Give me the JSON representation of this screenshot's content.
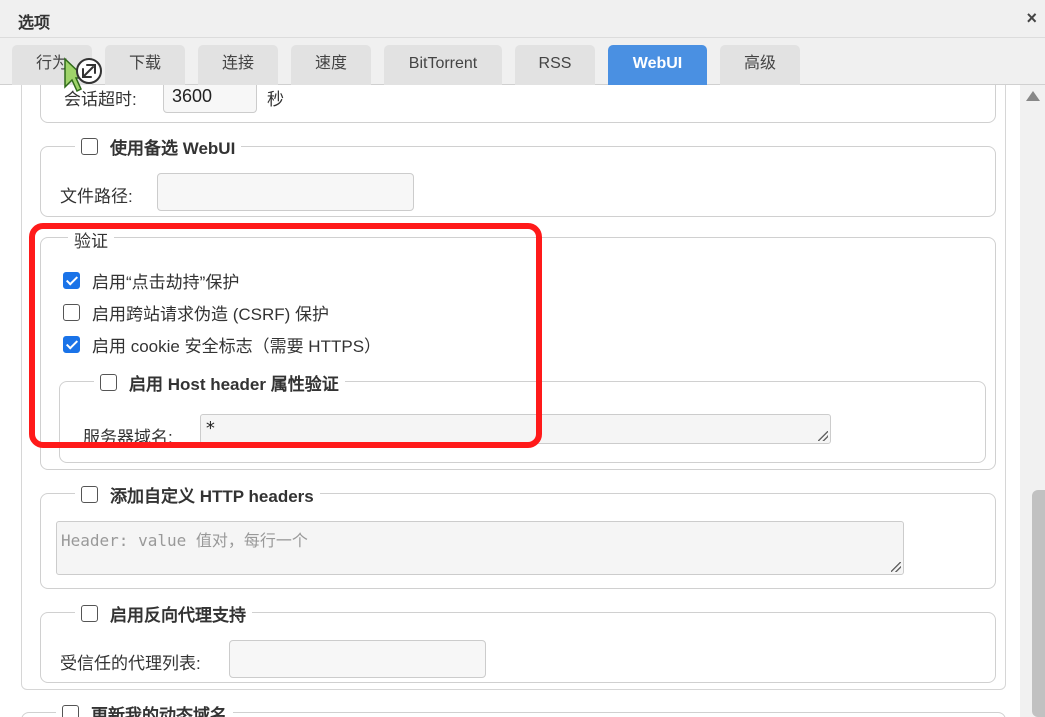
{
  "window": {
    "title": "选项",
    "close_label": "×"
  },
  "tabs": [
    {
      "label": "行为",
      "active": false
    },
    {
      "label": "下载",
      "active": false
    },
    {
      "label": "连接",
      "active": false
    },
    {
      "label": "速度",
      "active": false
    },
    {
      "label": "BitTorrent",
      "active": false
    },
    {
      "label": "RSS",
      "active": false
    },
    {
      "label": "WebUI",
      "active": true
    },
    {
      "label": "高级",
      "active": false
    }
  ],
  "session": {
    "timeout_label": "会话超时:",
    "timeout_value": "3600",
    "timeout_unit": "秒"
  },
  "alt_webui": {
    "legend": "使用备选 WebUI",
    "checked": false,
    "path_label": "文件路径:",
    "path_value": ""
  },
  "auth": {
    "legend": "验证",
    "clickjacking": {
      "label": "启用“点击劫持”保护",
      "checked": true
    },
    "csrf": {
      "label": "启用跨站请求伪造 (CSRF) 保护",
      "checked": false
    },
    "cookie": {
      "label": "启用 cookie 安全标志（需要 HTTPS）",
      "checked": true
    },
    "host_header": {
      "legend": "启用 Host header 属性验证",
      "checked": false,
      "domains_label": "服务器域名:",
      "domains_value": "*"
    }
  },
  "custom_headers": {
    "legend": "添加自定义 HTTP headers",
    "checked": false,
    "placeholder": "Header: value 值对，每行一个"
  },
  "reverse_proxy": {
    "legend": "启用反向代理支持",
    "checked": false,
    "trusted_label": "受信任的代理列表:",
    "trusted_value": ""
  },
  "dyndns": {
    "legend": "更新我的动态域名",
    "checked": false
  },
  "colors": {
    "accent": "#4a90e2",
    "highlight": "#ff1a1a",
    "checkbox_checked": "#1a73e8"
  }
}
